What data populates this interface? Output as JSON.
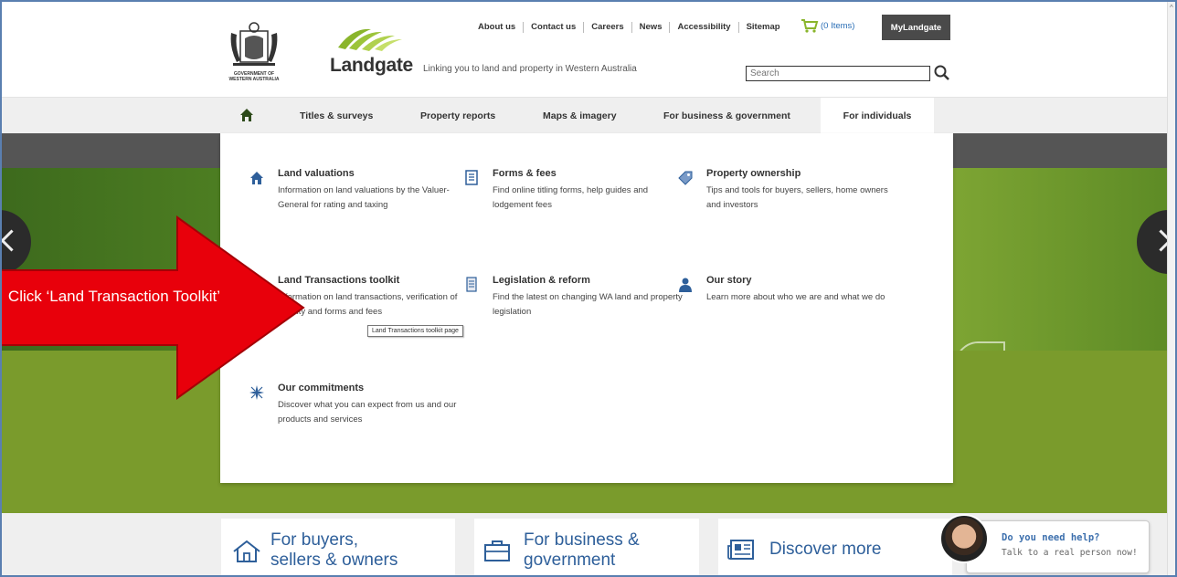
{
  "header": {
    "gov_crest_text": "GOVERNMENT OF WESTERN AUSTRALIA",
    "brand_name": "Landgate",
    "tagline": "Linking you to land and property in Western Australia",
    "top_links": [
      "About us",
      "Contact us",
      "Careers",
      "News",
      "Accessibility",
      "Sitemap"
    ],
    "cart_label": "(0 Items)",
    "my_landgate_label": "MyLandgate",
    "search_placeholder": "Search"
  },
  "nav": {
    "items": [
      "Titles & surveys",
      "Property reports",
      "Maps & imagery",
      "For business & government",
      "For individuals"
    ],
    "active": "For individuals"
  },
  "mega_menu": {
    "items": [
      {
        "title": "Land valuations",
        "desc": "Information on land valuations by the Valuer-General for rating and taxing",
        "icon": "house-icon"
      },
      {
        "title": "Forms & fees",
        "desc": "Find online titling forms, help guides and lodgement fees",
        "icon": "form-icon"
      },
      {
        "title": "Property ownership",
        "desc": "Tips and tools for buyers, sellers, home owners and investors",
        "icon": "tag-icon"
      },
      {
        "title": "Land Transactions toolkit",
        "desc": "Information on land transactions, verification of identity and forms and fees",
        "icon": "toolkit-icon"
      },
      {
        "title": "Legislation & reform",
        "desc": "Find the latest on changing WA land and property legislation",
        "icon": "document-icon"
      },
      {
        "title": "Our story",
        "desc": "Learn more about who we are and what we do",
        "icon": "person-icon"
      },
      {
        "title": "Our commitments",
        "desc": "Discover what you can expect from us and our products and services",
        "icon": "star-icon"
      }
    ],
    "tooltip": "Land Transactions toolkit  page"
  },
  "cards": [
    {
      "title_line1": "For buyers,",
      "title_line2": "sellers & owners"
    },
    {
      "title_line1": "For business &",
      "title_line2": "government"
    },
    {
      "title_line1": "Discover more",
      "title_line2": ""
    }
  ],
  "help": {
    "title": "Do you need help?",
    "subtitle": "Talk to a real person now!"
  },
  "annotation": {
    "text": "Click ‘Land Transaction Toolkit’",
    "color": "#e8000b"
  }
}
